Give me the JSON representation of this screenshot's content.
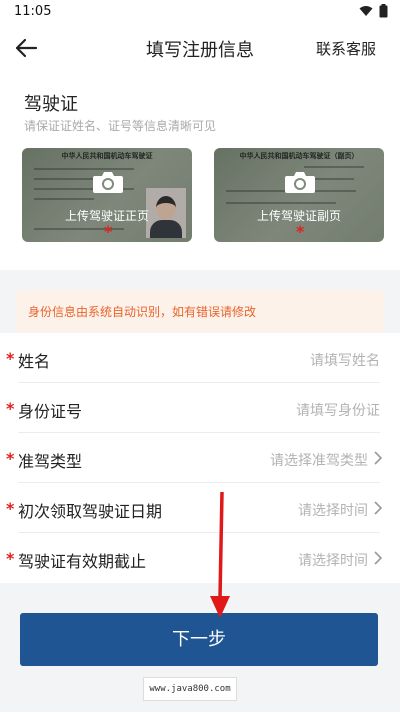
{
  "status_bar": {
    "time": "11:05"
  },
  "nav": {
    "title": "填写注册信息",
    "action": "联系客服"
  },
  "license": {
    "title": "驾驶证",
    "hint": "请保证证姓名、证号等信息清晰可见",
    "front": {
      "label": "上传驾驶证正页",
      "card_head": "中华人民共和国机动车驾驶证"
    },
    "back": {
      "label": "上传驾驶证副页",
      "card_head": "中华人民共和国机动车驾驶证（副页）"
    }
  },
  "notice": "身份信息由系统自动识别，如有错误请修改",
  "form": {
    "rows": [
      {
        "label": "姓名",
        "placeholder": "请填写姓名",
        "arrow": false
      },
      {
        "label": "身份证号",
        "placeholder": "请填写身份证",
        "arrow": false
      },
      {
        "label": "准驾类型",
        "placeholder": "请选择准驾类型",
        "arrow": true
      },
      {
        "label": "初次领取驾驶证日期",
        "placeholder": "请选择时间",
        "arrow": true
      },
      {
        "label": "驾驶证有效期截止",
        "placeholder": "请选择时间",
        "arrow": true
      }
    ]
  },
  "required_mark": "*",
  "next_button": "下一步",
  "watermark": "www.java800.com",
  "colors": {
    "primary": "#1f5592",
    "required": "#e02020",
    "notice_text": "#e8632c",
    "notice_bg": "#fdf2ea"
  },
  "icons": [
    "wifi-icon",
    "battery-icon",
    "back-arrow-icon",
    "camera-icon",
    "chevron-right-icon"
  ]
}
